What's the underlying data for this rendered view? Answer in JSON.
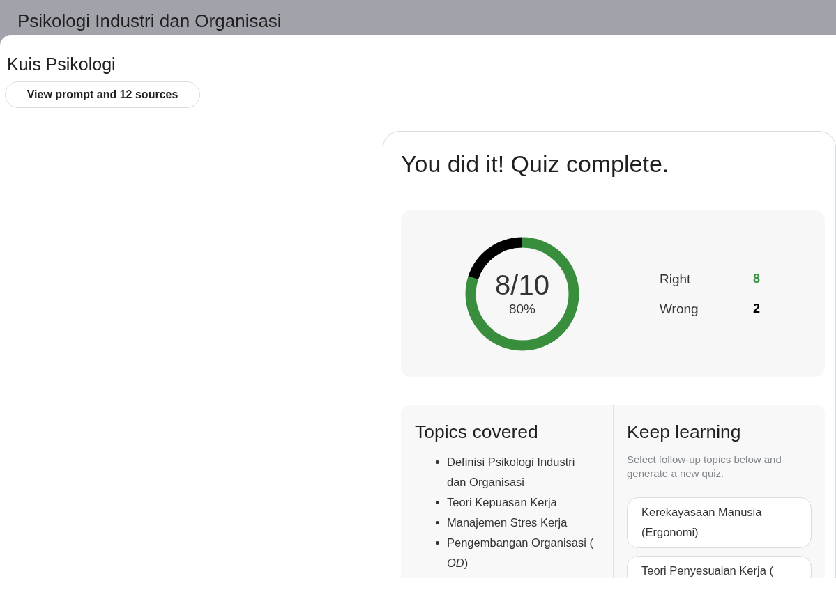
{
  "header": {
    "title": "Psikologi Industri dan Organisasi"
  },
  "page": {
    "title": "Kuis Psikologi",
    "sources_button": "View prompt and 12 sources"
  },
  "quiz_result": {
    "title": "You did it! Quiz complete.",
    "score": {
      "fraction": "8/10",
      "percent": "80%",
      "level": 0.8
    },
    "stats": [
      {
        "label": "Right",
        "value": "8",
        "color": "#388e3c"
      },
      {
        "label": "Wrong",
        "value": "2",
        "color": "#000000"
      }
    ],
    "topics_covered": {
      "title": "Topics covered",
      "items": [
        "Definisi Psikologi Industri dan Organisasi",
        "Teori Kepuasan Kerja",
        "Manajemen Stres Kerja",
        "Pengembangan Organisasi ( *OD*)"
      ]
    },
    "keep_learning": {
      "title": "Keep learning",
      "description": "Select follow-up topics below and generate a new quiz.",
      "topics": [
        {
          "label": "Kerekayasaan Manusia (Ergonomi)",
          "selected": false
        },
        {
          "label": "Teori Penyesuaian Kerja (",
          "selected": false
        }
      ]
    }
  }
}
